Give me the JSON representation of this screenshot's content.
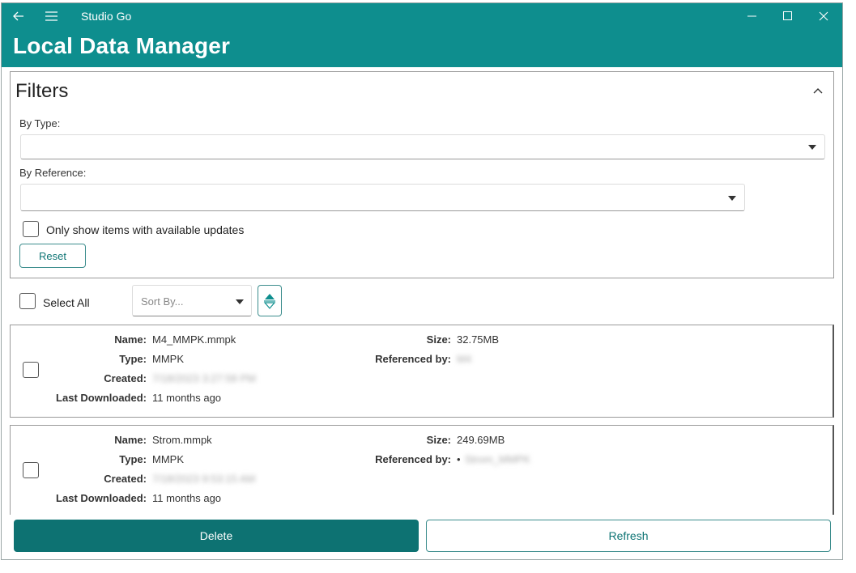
{
  "window": {
    "app_title": "Studio Go",
    "icons": {
      "back": "arrow-left-icon",
      "menu": "hamburger-icon",
      "minimize": "minimize-icon",
      "maximize": "maximize-icon",
      "close": "close-icon"
    }
  },
  "header": {
    "title": "Local Data Manager"
  },
  "filters": {
    "title": "Filters",
    "collapse_icon": "chevron-up-icon",
    "by_type_label": "By Type:",
    "by_type_value": "",
    "by_reference_label": "By Reference:",
    "by_reference_value": "",
    "updates_only_label": "Only show items with available updates",
    "updates_only_checked": false,
    "reset_label": "Reset"
  },
  "toolbar": {
    "select_all_label": "Select All",
    "sort_placeholder": "Sort By...",
    "sort_direction_icon": "sort-toggle-icon"
  },
  "items": [
    {
      "name_label": "Name:",
      "name": "M4_MMPK.mmpk",
      "type_label": "Type:",
      "type": "MMPK",
      "created_label": "Created:",
      "created": "7/18/2023 3:27:58 PM",
      "last_downloaded_label": "Last Downloaded:",
      "last_downloaded": "11 months ago",
      "size_label": "Size:",
      "size": "32.75MB",
      "referenced_by_label": "Referenced by:",
      "referenced_by": "M4",
      "checked": false
    },
    {
      "name_label": "Name:",
      "name": "Strom.mmpk",
      "type_label": "Type:",
      "type": "MMPK",
      "created_label": "Created:",
      "created": "7/18/2023 9:53:15 AM",
      "last_downloaded_label": "Last Downloaded:",
      "last_downloaded": "11 months ago",
      "size_label": "Size:",
      "size": "249.69MB",
      "referenced_by_label": "Referenced by:",
      "referenced_by": "Strom_MMPK",
      "checked": false
    }
  ],
  "footer": {
    "delete_label": "Delete",
    "refresh_label": "Refresh"
  },
  "colors": {
    "accent": "#0e8e8e",
    "accent_dark": "#0d7272",
    "border": "#9a9a9a"
  }
}
